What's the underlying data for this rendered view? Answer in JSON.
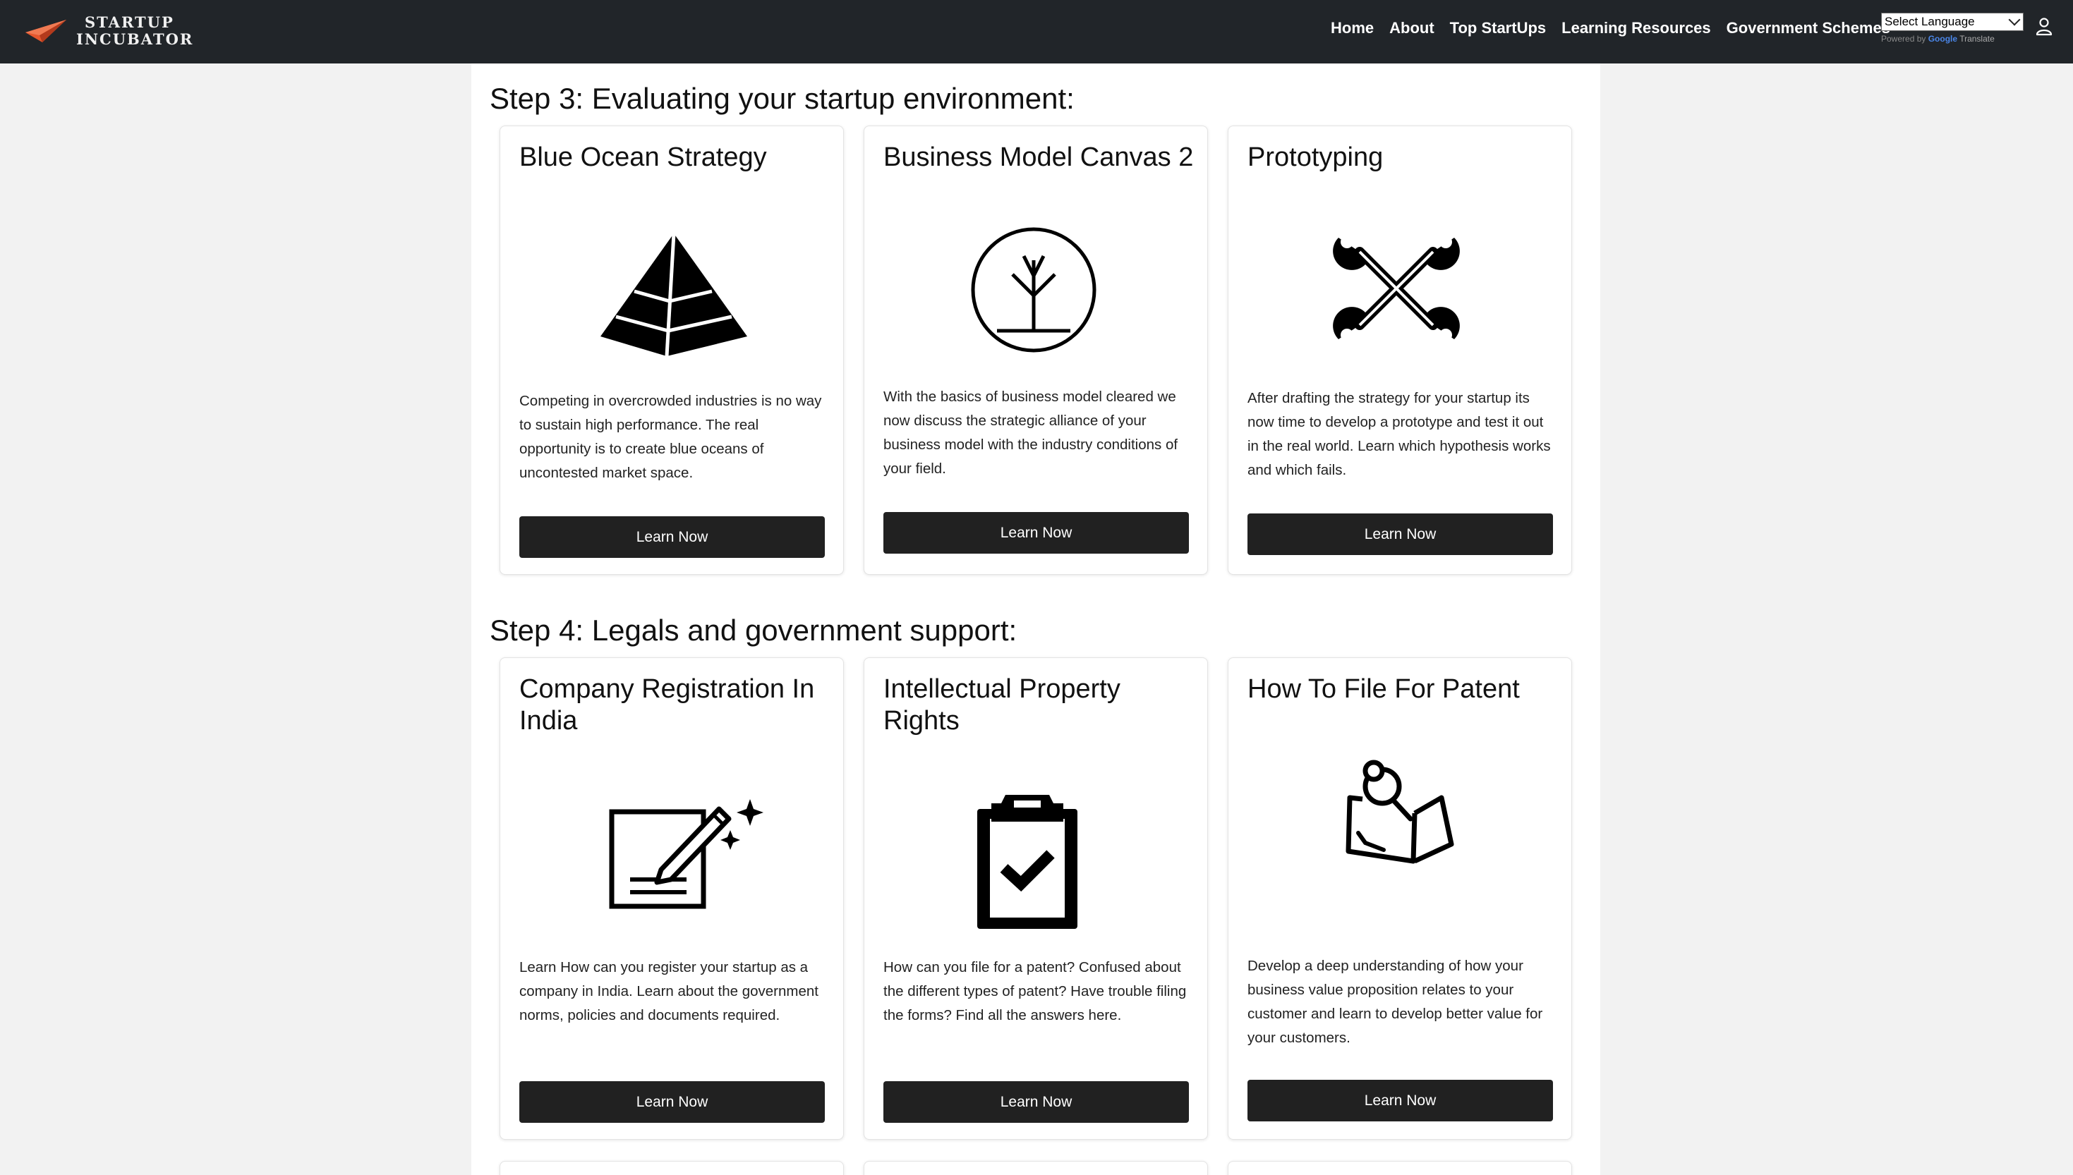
{
  "brand": {
    "line1": "STARTUP",
    "line2": "INCUBATOR"
  },
  "nav": {
    "links": [
      "Home",
      "About",
      "Top StartUps",
      "Learning Resources",
      "Government Schemes"
    ],
    "language_select": "Select Language",
    "powered_by": "Powered by",
    "google": "Google",
    "translate": "Translate"
  },
  "step3": {
    "title": "Step 3: Evaluating your startup environment:",
    "cards": [
      {
        "title": "Blue Ocean Strategy",
        "icon": "pyramid-icon",
        "text": "Competing in overcrowded industries is no way to sustain high performance. The real opportunity is to create blue oceans of uncontested market space.",
        "button": "Learn Now"
      },
      {
        "title": "Business Model Canvas 2",
        "icon": "tree-circle-icon",
        "text": "With the basics of business model cleared we now discuss the strategic alliance of your business model with the industry conditions of your field.",
        "button": "Learn Now"
      },
      {
        "title": "Prototyping",
        "icon": "crossed-wrenches-icon",
        "text": "After drafting the strategy for your startup its now time to develop a prototype and test it out in the real world. Learn which hypothesis works and which fails.",
        "button": "Learn Now"
      }
    ]
  },
  "step4": {
    "title": "Step 4: Legals and government support:",
    "cards": [
      {
        "title": "Company Registration In India",
        "icon": "document-pen-icon",
        "text": "Learn How can you register your startup as a company in India. Learn about the government norms, policies and documents required.",
        "button": "Learn Now"
      },
      {
        "title": "Intellectual Property Rights",
        "icon": "clipboard-check-icon",
        "text": "How can you file for a patent? Confused about the different types of patent? Have trouble filing the forms? Find all the answers here.",
        "button": "Learn Now"
      },
      {
        "title": "How To File For Patent",
        "icon": "pinned-note-icon",
        "text": "Develop a deep understanding of how your business value proposition relates to your customer and learn to develop better value for your customers.",
        "button": "Learn Now"
      }
    ]
  }
}
